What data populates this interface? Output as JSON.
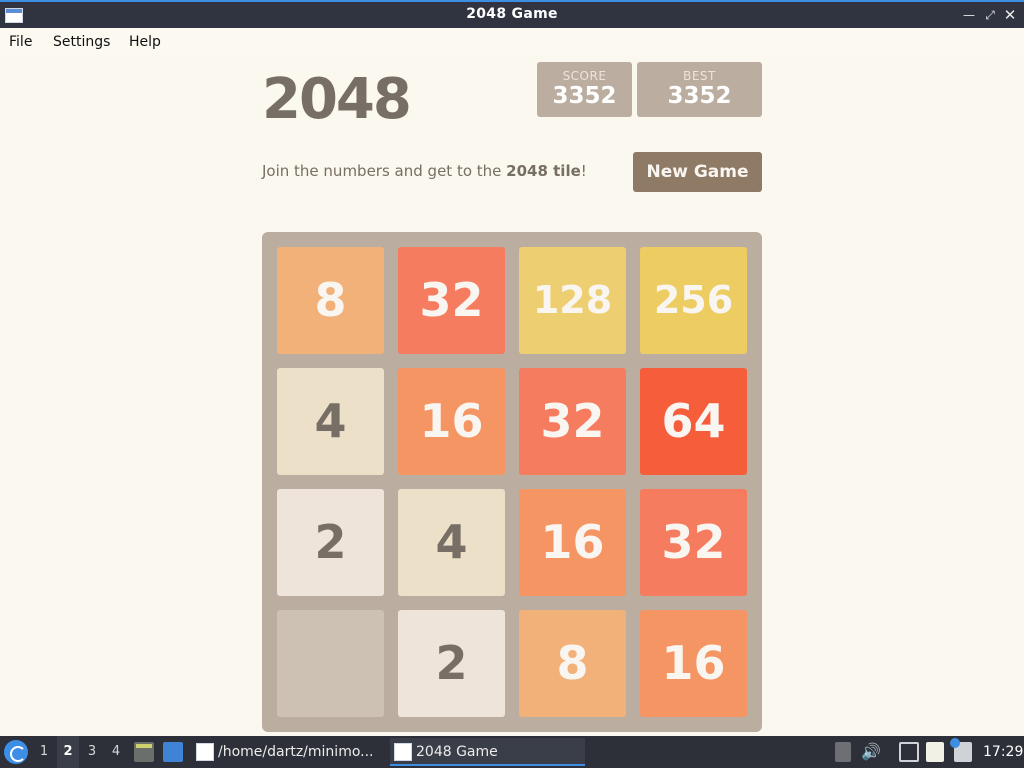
{
  "window": {
    "title": "2048 Game"
  },
  "menu": [
    "File",
    "Settings",
    "Help"
  ],
  "game": {
    "title": "2048",
    "score_label": "SCORE",
    "score": "3352",
    "best_label": "BEST",
    "best": "3352",
    "intro_prefix": "Join the numbers and get to the ",
    "intro_bold": "2048 tile",
    "intro_suffix": "!",
    "new_game_label": "New Game"
  },
  "board": [
    [
      "8",
      "32",
      "128",
      "256"
    ],
    [
      "4",
      "16",
      "32",
      "64"
    ],
    [
      "2",
      "4",
      "16",
      "32"
    ],
    [
      "",
      "2",
      "8",
      "16"
    ]
  ],
  "tile_colors": {
    "2": {
      "bg": "#eee4da",
      "fg": "#776e65"
    },
    "4": {
      "bg": "#ede0c8",
      "fg": "#776e65"
    },
    "8": {
      "bg": "#f2b179",
      "fg": "#f9f6f2"
    },
    "16": {
      "bg": "#f59563",
      "fg": "#f9f6f2"
    },
    "32": {
      "bg": "#f67c5f",
      "fg": "#f9f6f2"
    },
    "64": {
      "bg": "#f65e3b",
      "fg": "#f9f6f2"
    },
    "128": {
      "bg": "#edcf72",
      "fg": "#f9f6f2"
    },
    "256": {
      "bg": "#edcc61",
      "fg": "#f9f6f2"
    }
  },
  "taskbar": {
    "workspaces": [
      "1",
      "2",
      "3",
      "4"
    ],
    "active_workspace": "2",
    "tasks": [
      "/home/dartz/minimo...",
      "2048 Game"
    ],
    "active_task": "2048 Game",
    "clock": "17:29"
  },
  "colors": {
    "background": "#faf8ef",
    "board": "#bbada0",
    "empty_cell": "#cdc1b4",
    "button": "#8f7a66",
    "text": "#776e65"
  }
}
